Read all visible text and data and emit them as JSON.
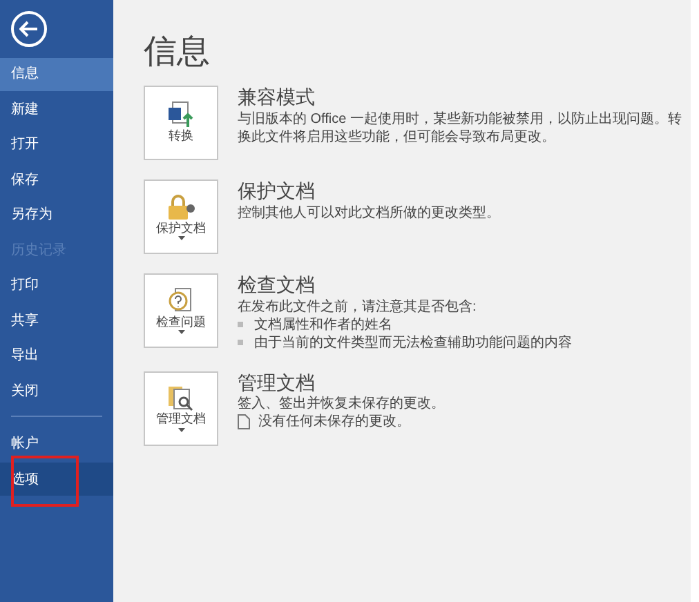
{
  "sidebar": {
    "items": [
      {
        "label": "信息",
        "selected": true,
        "disabled": false,
        "highlighted": false
      },
      {
        "label": "新建",
        "selected": false,
        "disabled": false,
        "highlighted": false
      },
      {
        "label": "打开",
        "selected": false,
        "disabled": false,
        "highlighted": false
      },
      {
        "label": "保存",
        "selected": false,
        "disabled": false,
        "highlighted": false
      },
      {
        "label": "另存为",
        "selected": false,
        "disabled": false,
        "highlighted": false
      },
      {
        "label": "历史记录",
        "selected": false,
        "disabled": true,
        "highlighted": false
      },
      {
        "label": "打印",
        "selected": false,
        "disabled": false,
        "highlighted": false
      },
      {
        "label": "共享",
        "selected": false,
        "disabled": false,
        "highlighted": false
      },
      {
        "label": "导出",
        "selected": false,
        "disabled": false,
        "highlighted": false
      },
      {
        "label": "关闭",
        "selected": false,
        "disabled": false,
        "highlighted": false
      }
    ],
    "bottom_items": [
      {
        "label": "帐户",
        "selected": false,
        "disabled": false,
        "highlighted": false
      },
      {
        "label": "选项",
        "selected": false,
        "disabled": false,
        "highlighted": true
      }
    ]
  },
  "page_title": "信息",
  "sections": [
    {
      "kind": "convert",
      "button": "转换",
      "dropdown": false,
      "title": "兼容模式",
      "description": "与旧版本的 Office 一起使用时，某些新功能被禁用，以防止出现问题。转换此文件将启用这些功能，但可能会导致布局更改。"
    },
    {
      "kind": "protect",
      "button": "保护文档",
      "dropdown": true,
      "title": "保护文档",
      "description": "控制其他人可以对此文档所做的更改类型。"
    },
    {
      "kind": "inspect",
      "button": "检查问题",
      "dropdown": true,
      "title": "检查文档",
      "description": "在发布此文件之前，请注意其是否包含:",
      "bullets": [
        "文档属性和作者的姓名",
        "由于当前的文件类型而无法检查辅助功能问题的内容"
      ]
    },
    {
      "kind": "manage",
      "button": "管理文档",
      "dropdown": true,
      "title": "管理文档",
      "description": "签入、签出并恢复未保存的更改。",
      "note": "没有任何未保存的更改。"
    }
  ]
}
